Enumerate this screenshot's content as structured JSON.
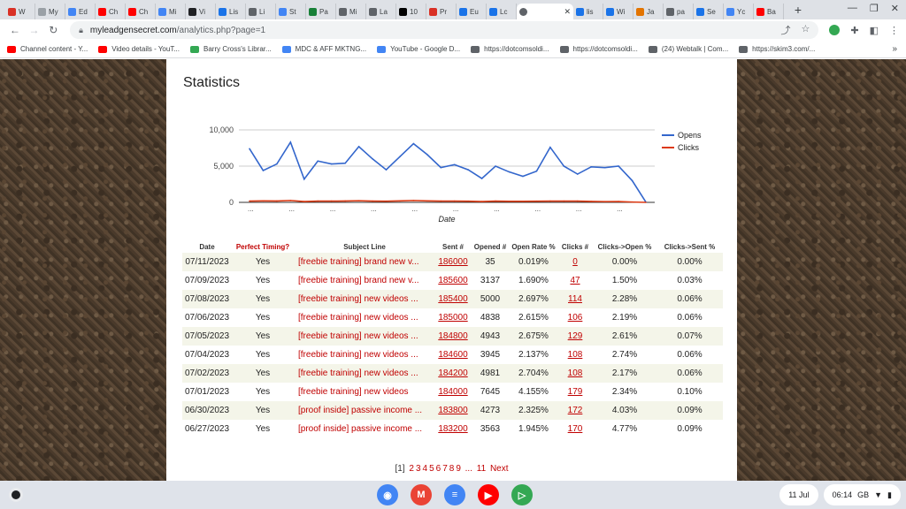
{
  "browser": {
    "tabs": [
      {
        "label": "W",
        "color": "#d93025"
      },
      {
        "label": "My",
        "color": "#9aa0a6"
      },
      {
        "label": "Ed",
        "color": "#4285f4"
      },
      {
        "label": "Ch",
        "color": "#ff0000"
      },
      {
        "label": "Ch",
        "color": "#ff0000"
      },
      {
        "label": "Mi",
        "color": "#4285f4"
      },
      {
        "label": "Vi",
        "color": "#202124"
      },
      {
        "label": "Lis",
        "color": "#1a73e8"
      },
      {
        "label": "Li",
        "color": "#5f6368"
      },
      {
        "label": "St",
        "color": "#4285f4"
      },
      {
        "label": "Pa",
        "color": "#188038"
      },
      {
        "label": "Mi",
        "color": "#5f6368"
      },
      {
        "label": "La",
        "color": "#5f6368"
      },
      {
        "label": "10",
        "color": "#000000"
      },
      {
        "label": "Pr",
        "color": "#d93025"
      },
      {
        "label": "Eu",
        "color": "#1a73e8"
      },
      {
        "label": "Lc",
        "color": "#1a73e8"
      }
    ],
    "active_tab": {
      "label": "",
      "close": "✕"
    },
    "tabs_after": [
      {
        "label": "lis",
        "color": "#1a73e8"
      },
      {
        "label": "Wi",
        "color": "#1a73e8"
      },
      {
        "label": "Ja",
        "color": "#e37400"
      },
      {
        "label": "pa",
        "color": "#5f6368"
      },
      {
        "label": "Se",
        "color": "#1a73e8"
      },
      {
        "label": "Yc",
        "color": "#4285f4"
      },
      {
        "label": "Ba",
        "color": "#ff0000"
      }
    ],
    "url_host": "myleadgensecret.com",
    "url_path": "/analytics.php?page=1",
    "bookmarks": [
      {
        "label": "Channel content - Y...",
        "color": "#ff0000"
      },
      {
        "label": "Video details - YouT...",
        "color": "#ff0000"
      },
      {
        "label": "Barry Cross's Librar...",
        "color": "#34a853"
      },
      {
        "label": "MDC & AFF MKTNG...",
        "color": "#4285f4"
      },
      {
        "label": "YouTube - Google D...",
        "color": "#4285f4"
      },
      {
        "label": "https://dotcomsoldi...",
        "color": "#5f6368"
      },
      {
        "label": "https://dotcomsoldi...",
        "color": "#5f6368"
      },
      {
        "label": "(24) Webtalk | Com...",
        "color": "#5f6368"
      },
      {
        "label": "https://skim3.com/...",
        "color": "#5f6368"
      }
    ],
    "bookmarks_more": "»"
  },
  "page": {
    "title": "Statistics",
    "table_headers": {
      "date": "Date",
      "perfect_timing": "Perfect Timing?",
      "subject": "Subject Line",
      "sent": "Sent #",
      "opened": "Opened #",
      "open_rate": "Open Rate %",
      "clicks": "Clicks #",
      "clicks_open": "Clicks->Open %",
      "clicks_sent": "Clicks->Sent %"
    },
    "rows": [
      {
        "date": "07/11/2023",
        "timing": "Yes",
        "subject": "[freebie training] brand new v...",
        "sent": "186000",
        "opened": "35",
        "open_rate": "0.019%",
        "clicks": "0",
        "clicks_open": "0.00%",
        "clicks_sent": "0.00%"
      },
      {
        "date": "07/09/2023",
        "timing": "Yes",
        "subject": "[freebie training] brand new v...",
        "sent": "185600",
        "opened": "3137",
        "open_rate": "1.690%",
        "clicks": "47",
        "clicks_open": "1.50%",
        "clicks_sent": "0.03%"
      },
      {
        "date": "07/08/2023",
        "timing": "Yes",
        "subject": "[freebie training] new videos ...",
        "sent": "185400",
        "opened": "5000",
        "open_rate": "2.697%",
        "clicks": "114",
        "clicks_open": "2.28%",
        "clicks_sent": "0.06%"
      },
      {
        "date": "07/06/2023",
        "timing": "Yes",
        "subject": "[freebie training] new videos ...",
        "sent": "185000",
        "opened": "4838",
        "open_rate": "2.615%",
        "clicks": "106",
        "clicks_open": "2.19%",
        "clicks_sent": "0.06%"
      },
      {
        "date": "07/05/2023",
        "timing": "Yes",
        "subject": "[freebie training] new videos ...",
        "sent": "184800",
        "opened": "4943",
        "open_rate": "2.675%",
        "clicks": "129",
        "clicks_open": "2.61%",
        "clicks_sent": "0.07%"
      },
      {
        "date": "07/04/2023",
        "timing": "Yes",
        "subject": "[freebie training] new videos ...",
        "sent": "184600",
        "opened": "3945",
        "open_rate": "2.137%",
        "clicks": "108",
        "clicks_open": "2.74%",
        "clicks_sent": "0.06%"
      },
      {
        "date": "07/02/2023",
        "timing": "Yes",
        "subject": "[freebie training] new videos ...",
        "sent": "184200",
        "opened": "4981",
        "open_rate": "2.704%",
        "clicks": "108",
        "clicks_open": "2.17%",
        "clicks_sent": "0.06%"
      },
      {
        "date": "07/01/2023",
        "timing": "Yes",
        "subject": "[freebie training] new videos",
        "sent": "184000",
        "opened": "7645",
        "open_rate": "4.155%",
        "clicks": "179",
        "clicks_open": "2.34%",
        "clicks_sent": "0.10%"
      },
      {
        "date": "06/30/2023",
        "timing": "Yes",
        "subject": "[proof inside] passive income ...",
        "sent": "183800",
        "opened": "4273",
        "open_rate": "2.325%",
        "clicks": "172",
        "clicks_open": "4.03%",
        "clicks_sent": "0.09%"
      },
      {
        "date": "06/27/2023",
        "timing": "Yes",
        "subject": "[proof inside] passive income ...",
        "sent": "183200",
        "opened": "3563",
        "open_rate": "1.945%",
        "clicks": "170",
        "clicks_open": "4.77%",
        "clicks_sent": "0.09%"
      }
    ],
    "pager": {
      "current": "[1]",
      "pages": [
        "2",
        "3",
        "4",
        "5",
        "6",
        "7",
        "8",
        "9"
      ],
      "ellipsis": "...",
      "last": "11",
      "next": "Next"
    }
  },
  "chart_data": {
    "type": "line",
    "xlabel": "Date",
    "ylabel": "",
    "ylim": [
      0,
      10000
    ],
    "yticks": [
      "0",
      "5,000",
      "10,000"
    ],
    "xtick_label": "...",
    "legend_position": "right",
    "series": [
      {
        "name": "Opens",
        "color": "#3366cc",
        "values": [
          7400,
          4400,
          5300,
          8300,
          3200,
          5700,
          5300,
          5400,
          7700,
          6000,
          4500,
          6300,
          8100,
          6600,
          4800,
          5200,
          4500,
          3300,
          5000,
          4200,
          3600,
          4300,
          7600,
          5000,
          3900,
          4900,
          4800,
          5000,
          3000,
          35
        ]
      },
      {
        "name": "Clicks",
        "color": "#dc3912",
        "values": [
          180,
          200,
          190,
          260,
          120,
          180,
          170,
          190,
          230,
          180,
          160,
          200,
          260,
          210,
          170,
          180,
          160,
          120,
          170,
          150,
          140,
          160,
          179,
          172,
          170,
          129,
          108,
          114,
          47,
          0
        ]
      }
    ]
  },
  "shelf": {
    "date": "11 Jul",
    "time": "06:14",
    "region": "GB",
    "apps": [
      {
        "name": "chrome",
        "color": "#4285f4",
        "glyph": "◉"
      },
      {
        "name": "gmail",
        "color": "#ea4335",
        "glyph": "M"
      },
      {
        "name": "docs",
        "color": "#4285f4",
        "glyph": "≡"
      },
      {
        "name": "youtube",
        "color": "#ff0000",
        "glyph": "▶"
      },
      {
        "name": "play-store",
        "color": "#34a853",
        "glyph": "▷"
      }
    ]
  }
}
